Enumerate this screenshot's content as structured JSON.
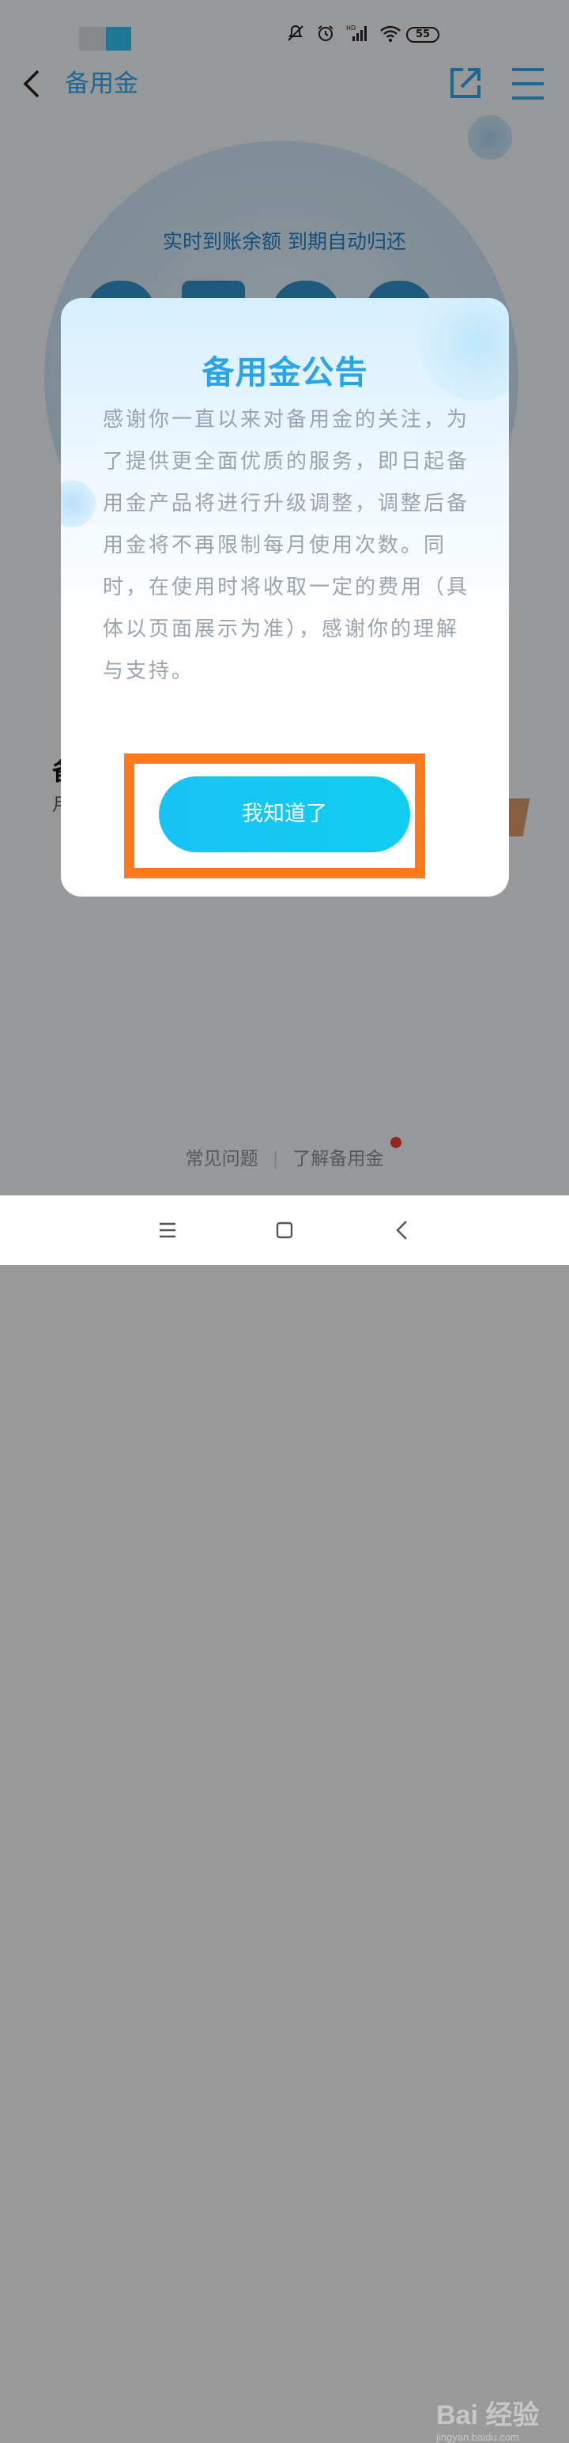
{
  "status_bar": {
    "battery": "55",
    "icons": [
      "mute-icon",
      "alarm-icon",
      "hd-signal-icon",
      "wifi-icon",
      "battery-icon"
    ],
    "network_label": "HD"
  },
  "nav": {
    "title": "备用金",
    "accent_color": "#2fa7f0"
  },
  "page": {
    "tagline": "实时到账余额 到期自动归还",
    "section_char": "备",
    "section_sub": "月"
  },
  "dialog": {
    "title": "备用金公告",
    "body": "感谢你一直以来对备用金的关注，为了提供更全面优质的服务，即日起备用金产品将进行升级调整，调整后备用金将不再限制每月使用次数。同时，在使用时将收取一定的费用（具体以页面展示为准），感谢你的理解与支持。",
    "button_label": "我知道了",
    "highlight_color": "#ff7a1c"
  },
  "footer": {
    "links": [
      "常见问题",
      "了解备用金"
    ],
    "separator": "|"
  },
  "watermark": {
    "brand": "Bai 经验",
    "url": "jingyan.baidu.com"
  }
}
